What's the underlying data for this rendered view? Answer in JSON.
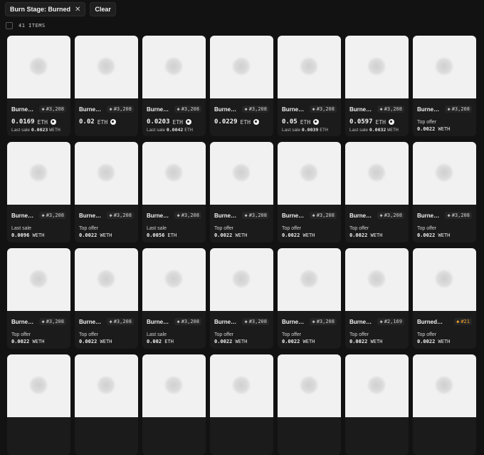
{
  "filters": {
    "active_chip": "Burn Stage: Burned",
    "clear_label": "Clear"
  },
  "results": {
    "count_label": "41 ITEMS"
  },
  "cards": [
    {
      "name": "Burne…",
      "rank": "#3,208",
      "variant": "price",
      "price": "0.0169",
      "currency": "ETH",
      "cart": true,
      "sub_label": "Last sale",
      "sub_value": "0.0023",
      "sub_currency": "WETH"
    },
    {
      "name": "Burne…",
      "rank": "#3,208",
      "variant": "price",
      "price": "0.02",
      "currency": "ETH",
      "cart": true
    },
    {
      "name": "Burne…",
      "rank": "#3,208",
      "variant": "price",
      "price": "0.0203",
      "currency": "ETH",
      "cart": true,
      "sub_label": "Last sale",
      "sub_value": "0.0042",
      "sub_currency": "ETH"
    },
    {
      "name": "Burne…",
      "rank": "#3,208",
      "variant": "price",
      "price": "0.0229",
      "currency": "ETH",
      "cart": true
    },
    {
      "name": "Burne…",
      "rank": "#3,208",
      "variant": "price",
      "price": "0.05",
      "currency": "ETH",
      "cart": true,
      "sub_label": "Last sale",
      "sub_value": "0.0039",
      "sub_currency": "ETH"
    },
    {
      "name": "Burne…",
      "rank": "#3,208",
      "variant": "price",
      "price": "0.0597",
      "currency": "ETH",
      "cart": true,
      "sub_label": "Last sale",
      "sub_value": "0.0032",
      "sub_currency": "WETH"
    },
    {
      "name": "Burne…",
      "rank": "#3,208",
      "variant": "offer",
      "label": "Top offer",
      "value": "0.0022",
      "currency": "WETH"
    },
    {
      "name": "Burne…",
      "rank": "#3,208",
      "variant": "offer",
      "label": "Last sale",
      "value": "0.0096",
      "currency": "WETH"
    },
    {
      "name": "Burne…",
      "rank": "#3,208",
      "variant": "offer",
      "label": "Top offer",
      "value": "0.0022",
      "currency": "WETH"
    },
    {
      "name": "Burne…",
      "rank": "#3,208",
      "variant": "offer",
      "label": "Last sale",
      "value": "0.0056",
      "currency": "ETH"
    },
    {
      "name": "Burne…",
      "rank": "#3,208",
      "variant": "offer",
      "label": "Top offer",
      "value": "0.0022",
      "currency": "WETH"
    },
    {
      "name": "Burne…",
      "rank": "#3,208",
      "variant": "offer",
      "label": "Top offer",
      "value": "0.0022",
      "currency": "WETH"
    },
    {
      "name": "Burne…",
      "rank": "#3,208",
      "variant": "offer",
      "label": "Top offer",
      "value": "0.0022",
      "currency": "WETH"
    },
    {
      "name": "Burne…",
      "rank": "#3,208",
      "variant": "offer",
      "label": "Top offer",
      "value": "0.0022",
      "currency": "WETH"
    },
    {
      "name": "Burne…",
      "rank": "#3,208",
      "variant": "offer",
      "label": "Top offer",
      "value": "0.0022",
      "currency": "WETH"
    },
    {
      "name": "Burne…",
      "rank": "#3,208",
      "variant": "offer",
      "label": "Top offer",
      "value": "0.0022",
      "currency": "WETH"
    },
    {
      "name": "Burne…",
      "rank": "#3,208",
      "variant": "offer",
      "label": "Last sale",
      "value": "0.002",
      "currency": "ETH"
    },
    {
      "name": "Burne…",
      "rank": "#3,208",
      "variant": "offer",
      "label": "Top offer",
      "value": "0.0022",
      "currency": "WETH"
    },
    {
      "name": "Burne…",
      "rank": "#3,208",
      "variant": "offer",
      "label": "Top offer",
      "value": "0.0022",
      "currency": "WETH"
    },
    {
      "name": "Burne…",
      "rank": "#2,169",
      "variant": "offer",
      "label": "Top offer",
      "value": "0.0022",
      "currency": "WETH"
    },
    {
      "name": "Burned P…",
      "rank": "#21",
      "rank_color": "orange",
      "variant": "offer",
      "label": "Top offer",
      "value": "0.0022",
      "currency": "WETH"
    },
    {
      "variant": "image-only"
    },
    {
      "variant": "image-only"
    },
    {
      "variant": "image-only"
    },
    {
      "variant": "image-only"
    },
    {
      "variant": "image-only"
    },
    {
      "variant": "image-only"
    },
    {
      "variant": "image-only"
    }
  ]
}
